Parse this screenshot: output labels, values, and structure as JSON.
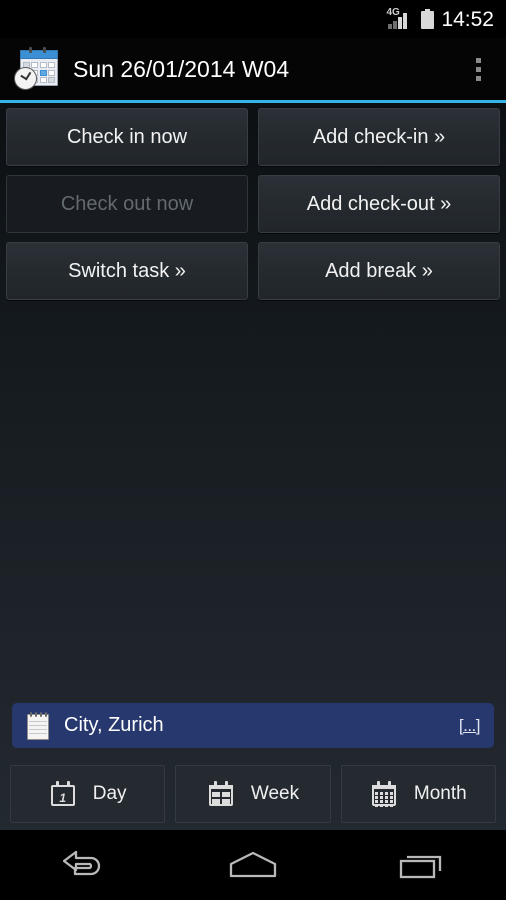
{
  "status_bar": {
    "network_label": "4G",
    "signal_icon": "signal-bars-icon",
    "battery_icon": "battery-icon",
    "time": "14:52"
  },
  "action_bar": {
    "app_icon": "calendar-clock-icon",
    "title": "Sun 26/01/2014 W04",
    "overflow_icon": "overflow-menu-icon",
    "accent_color": "#33b5e5"
  },
  "actions": [
    {
      "label": "Check in now",
      "name": "check-in-now-button",
      "enabled": true
    },
    {
      "label": "Add check-in »",
      "name": "add-check-in-button",
      "enabled": true
    },
    {
      "label": "Check out now",
      "name": "check-out-now-button",
      "enabled": false
    },
    {
      "label": "Add check-out »",
      "name": "add-check-out-button",
      "enabled": true
    },
    {
      "label": "Switch task »",
      "name": "switch-task-button",
      "enabled": true
    },
    {
      "label": "Add break »",
      "name": "add-break-button",
      "enabled": true
    }
  ],
  "note_bar": {
    "icon": "notepad-icon",
    "text": "City, Zurich",
    "more_label": "[...]",
    "background_color": "#27386e"
  },
  "tabs": [
    {
      "label": "Day",
      "icon": "calendar-day-icon",
      "name": "tab-day",
      "day_number": "1"
    },
    {
      "label": "Week",
      "icon": "calendar-week-icon",
      "name": "tab-week"
    },
    {
      "label": "Month",
      "icon": "calendar-month-icon",
      "name": "tab-month"
    }
  ],
  "nav_bar": {
    "back": "back-icon",
    "home": "home-icon",
    "recents": "recent-apps-icon"
  }
}
